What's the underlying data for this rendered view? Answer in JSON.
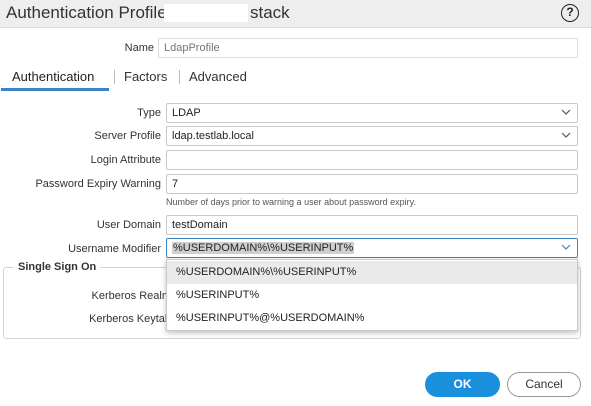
{
  "dialog": {
    "title_prefix": "Authentication Profile - ",
    "title_suffix": "stack",
    "help_glyph": "?"
  },
  "form": {
    "name_label": "Name",
    "name_placeholder": "LdapProfile"
  },
  "tabs": [
    {
      "label": "Authentication"
    },
    {
      "label": "Factors"
    },
    {
      "label": "Advanced"
    }
  ],
  "auth": {
    "type_label": "Type",
    "type_value": "LDAP",
    "server_profile_label": "Server Profile",
    "server_profile_value": "ldap.testlab.local",
    "login_attribute_label": "Login Attribute",
    "login_attribute_value": "",
    "password_expiry_label": "Password Expiry Warning",
    "password_expiry_value": "7",
    "password_expiry_hint": "Number of days prior to warning a user about password expiry.",
    "user_domain_label": "User Domain",
    "user_domain_value": "testDomain",
    "username_modifier_label": "Username Modifier",
    "username_modifier_value": "%USERDOMAIN%\\%USERINPUT%"
  },
  "username_modifier_options": [
    "%USERDOMAIN%\\%USERINPUT%",
    "%USERINPUT%",
    "%USERINPUT%@%USERDOMAIN%"
  ],
  "sso": {
    "legend": "Single Sign On",
    "kerberos_realm_label": "Kerberos Realm",
    "kerberos_keytab_label": "Kerberos Keytab"
  },
  "buttons": {
    "ok": "OK",
    "cancel": "Cancel"
  },
  "colors": {
    "accent": "#1a8fdc",
    "tab_underline": "#3a86c4",
    "selected_row": "#eaeaea"
  }
}
